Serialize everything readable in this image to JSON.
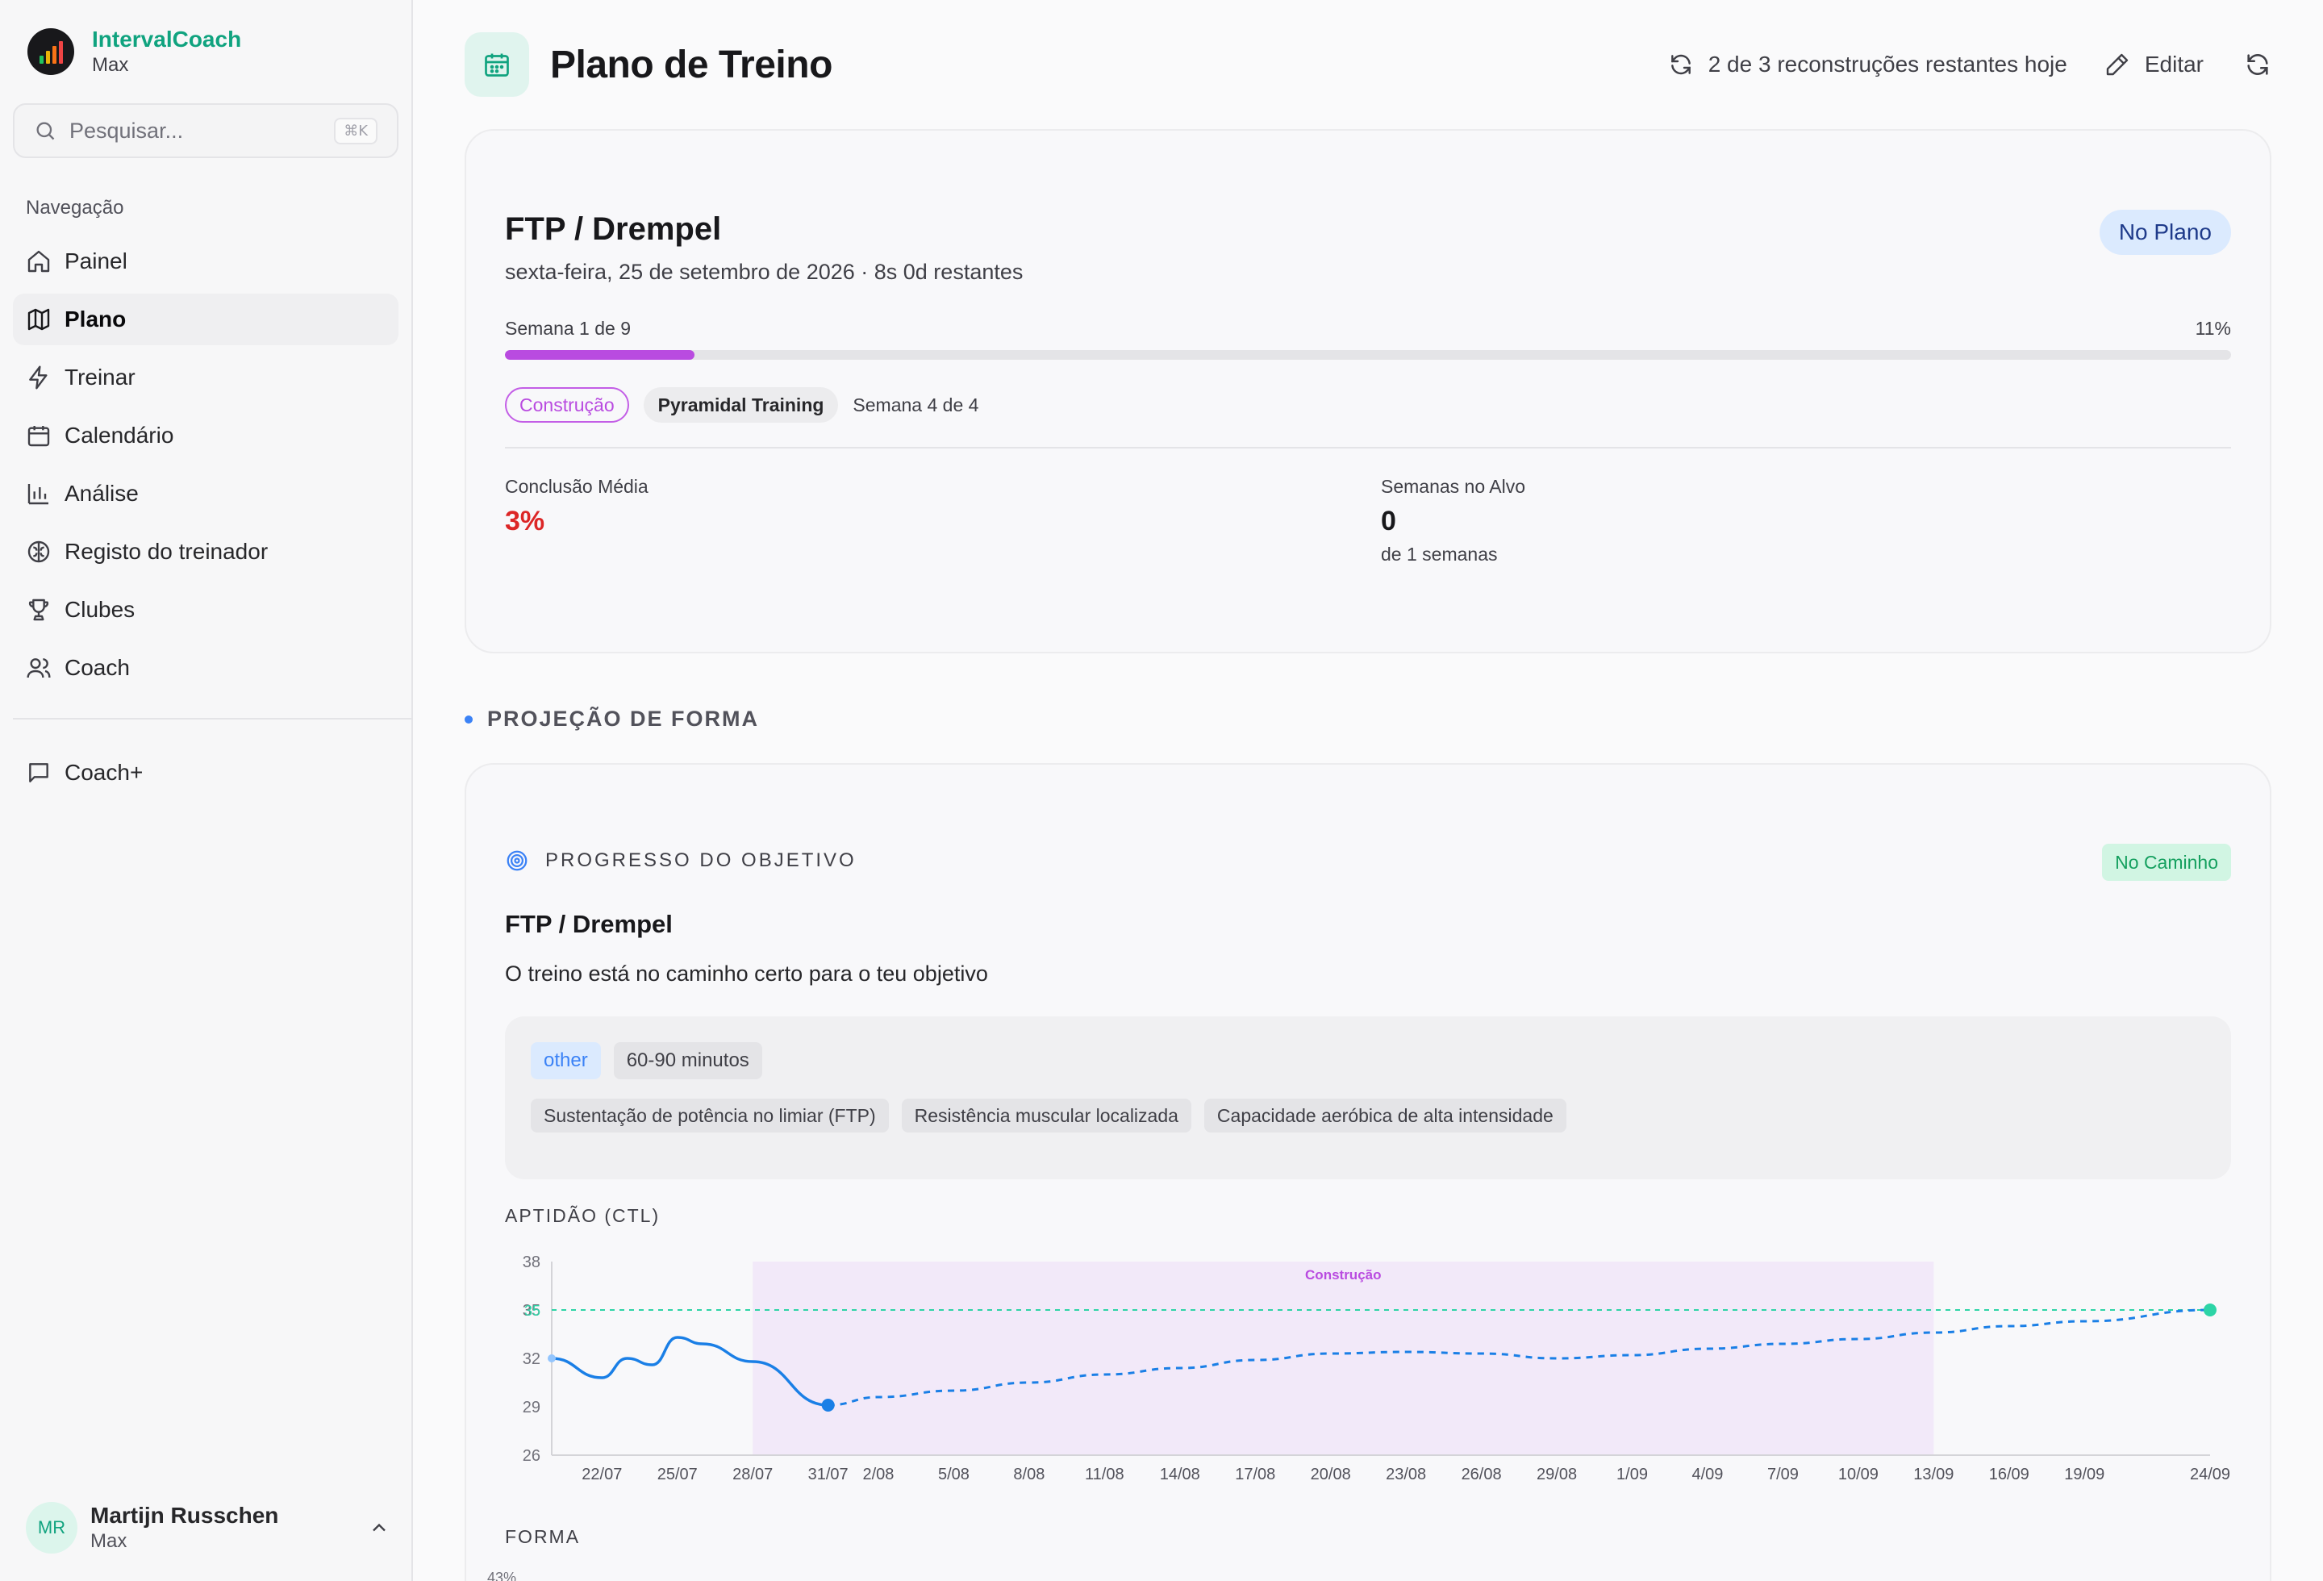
{
  "app": {
    "name": "IntervalCoach",
    "subtitle": "Max"
  },
  "search": {
    "placeholder": "Pesquisar...",
    "shortcut": "⌘K"
  },
  "sidebar": {
    "section_label": "Navegação",
    "items": [
      {
        "label": "Painel",
        "icon": "home-icon"
      },
      {
        "label": "Plano",
        "icon": "map-icon",
        "active": true
      },
      {
        "label": "Treinar",
        "icon": "zap-icon"
      },
      {
        "label": "Calendário",
        "icon": "calendar-icon"
      },
      {
        "label": "Análise",
        "icon": "bar-chart-icon"
      },
      {
        "label": "Registo do treinador",
        "icon": "brain-icon"
      },
      {
        "label": "Clubes",
        "icon": "trophy-icon"
      },
      {
        "label": "Coach",
        "icon": "users-icon"
      }
    ],
    "secondary": [
      {
        "label": "Coach+",
        "icon": "message-icon"
      }
    ]
  },
  "user": {
    "initials": "MR",
    "name": "Martijn Russchen",
    "subtitle": "Max"
  },
  "header": {
    "title": "Plano de Treino",
    "rebuilds": "2 de 3 reconstruções restantes hoje",
    "edit_label": "Editar"
  },
  "plan": {
    "title": "FTP / Drempel",
    "date_line": "sexta-feira, 25 de setembro de 2026 · 8s 0d restantes",
    "status_badge": "No Plano",
    "week_label": "Semana 1 de 9",
    "progress_label": "11%",
    "progress_fraction": 0.11,
    "phase_tag": "Construção",
    "block_tag": "Pyramidal Training",
    "block_week": "Semana 4 de 4",
    "avg_completion_label": "Conclusão Média",
    "avg_completion_value": "3%",
    "weeks_on_target_label": "Semanas no Alvo",
    "weeks_on_target_value": "0",
    "weeks_on_target_sub": "de 1 semanas"
  },
  "colors": {
    "accent": "#10a37f",
    "phase": "#b94be0",
    "danger": "#dc2626",
    "line": "#1a7fe6",
    "target": "#2dd4a6"
  },
  "projection": {
    "section_title": "PROJEÇÃO DE FORMA",
    "goal_header": "PROGRESSO DO OBJETIVO",
    "status_badge": "No Caminho",
    "title": "FTP / Drempel",
    "subtitle": "O treino está no caminho certo para o teu objetivo",
    "chips": [
      "other",
      "60-90 minutos"
    ],
    "focus_chips": [
      "Sustentação de potência no limiar (FTP)",
      "Resistência muscular localizada",
      "Capacidade aeróbica de alta intensidade"
    ],
    "fitness_label": "APTIDÃO (CTL)",
    "form_label": "FORMA",
    "form_first_tick": "43%"
  },
  "chart_data": {
    "type": "line",
    "title": "APTIDÃO (CTL)",
    "xlabel": "",
    "ylabel": "",
    "ylim": [
      26,
      38
    ],
    "yticks": [
      38,
      35,
      32,
      29,
      26
    ],
    "target": {
      "value": 35,
      "label": "35"
    },
    "phase_band": {
      "label": "Construção",
      "from": "28/07",
      "to": "13/09"
    },
    "xticks": [
      "22/07",
      "25/07",
      "28/07",
      "31/07",
      "2/08",
      "5/08",
      "8/08",
      "11/08",
      "14/08",
      "17/08",
      "20/08",
      "23/08",
      "26/08",
      "29/08",
      "1/09",
      "4/09",
      "7/09",
      "10/09",
      "13/09",
      "16/09",
      "19/09",
      "24/09"
    ],
    "series": [
      {
        "style": "solid",
        "x": [
          "20/07",
          "22/07",
          "23/07",
          "24/07",
          "25/07",
          "26/07",
          "28/07",
          "31/07"
        ],
        "values": [
          32.0,
          30.8,
          32.0,
          31.6,
          33.3,
          32.9,
          31.8,
          29.1
        ]
      },
      {
        "style": "dashed",
        "x": [
          "31/07",
          "2/08",
          "5/08",
          "8/08",
          "11/08",
          "14/08",
          "17/08",
          "20/08",
          "23/08",
          "26/08",
          "29/08",
          "1/09",
          "4/09",
          "7/09",
          "10/09",
          "13/09",
          "16/09",
          "19/09",
          "24/09"
        ],
        "values": [
          29.1,
          29.6,
          30.0,
          30.5,
          31.0,
          31.4,
          31.9,
          32.3,
          32.4,
          32.3,
          32.0,
          32.2,
          32.6,
          32.9,
          33.2,
          33.6,
          34.0,
          34.3,
          35.0
        ]
      }
    ]
  }
}
